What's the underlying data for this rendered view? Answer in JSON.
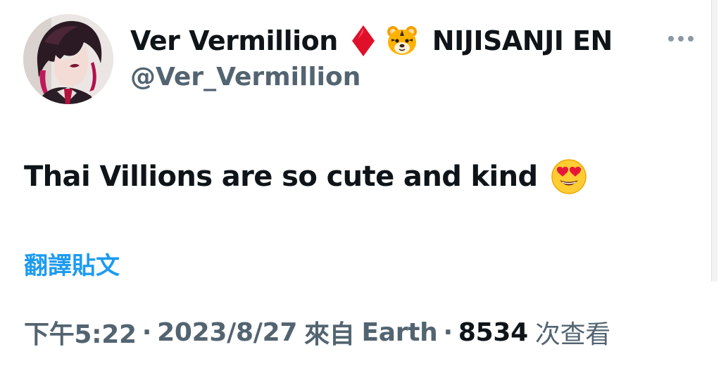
{
  "author": {
    "display_name": "Ver Vermillion",
    "org": "NIJISANJI EN",
    "handle": "@Ver_Vermillion",
    "badge_icons": [
      "red-diamond-icon",
      "tiger-face-icon"
    ],
    "avatar_icon": "profile-avatar"
  },
  "tweet": {
    "text": "Thai Villions are so cute and kind",
    "emoji_icon": "heart-eyes-emoji-icon"
  },
  "translate": {
    "label": "翻譯貼文"
  },
  "meta": {
    "time": "下午5:22",
    "separator": "·",
    "date": "2023/8/27",
    "source_prefix": "來自",
    "source": "Earth",
    "views_count": "8534",
    "views_label": "次查看"
  },
  "colors": {
    "text_primary": "#0f1419",
    "text_secondary": "#536471",
    "link": "#1d9bf0",
    "diamond": "#e0102a"
  }
}
